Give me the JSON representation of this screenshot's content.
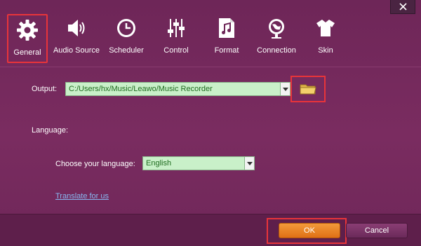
{
  "window": {
    "close_icon": "close-icon"
  },
  "toolbar": {
    "items": [
      {
        "label": "General",
        "icon": "gear-icon",
        "active": true
      },
      {
        "label": "Audio Source",
        "icon": "speaker-icon"
      },
      {
        "label": "Scheduler",
        "icon": "clock-icon"
      },
      {
        "label": "Control",
        "icon": "sliders-icon"
      },
      {
        "label": "Format",
        "icon": "music-file-icon"
      },
      {
        "label": "Connection",
        "icon": "globe-icon"
      },
      {
        "label": "Skin",
        "icon": "shirt-icon"
      }
    ]
  },
  "output": {
    "label": "Output:",
    "value": "C:/Users/hx/Music/Leawo/Music Recorder",
    "browse_icon": "folder-icon"
  },
  "language": {
    "section_label": "Language:",
    "choose_label": "Choose your language:",
    "value": "English",
    "translate_link": "Translate for us"
  },
  "buttons": {
    "ok": "OK",
    "cancel": "Cancel"
  },
  "colors": {
    "background": "#6e2658",
    "highlight": "#e8343a",
    "combo_bg": "#c9f0c9",
    "combo_text": "#1f6b1f",
    "ok_button": "#e07015",
    "link": "#88b8f0"
  }
}
